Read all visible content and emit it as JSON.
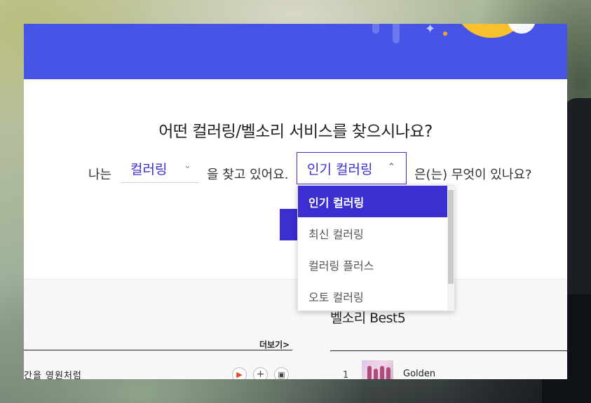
{
  "page": {
    "question": "어떤 컬러링/벨소리 서비스를 찾으시나요?",
    "sentence": {
      "prefix": "나는",
      "middle": "을 찾고 있어요.",
      "suffix": "은(는) 무엇이 있나요?"
    },
    "service_select": {
      "value": "컬러링"
    },
    "category_select": {
      "value": "인기 컬러링",
      "expanded": true,
      "options": [
        {
          "label": "인기 컬러링",
          "selected": true
        },
        {
          "label": "최신 컬러링",
          "selected": false
        },
        {
          "label": "컬러링 플러스",
          "selected": false
        },
        {
          "label": "오토 컬러링",
          "selected": false
        }
      ]
    }
  },
  "lower": {
    "more_link": "더보기>",
    "left_track": "간을 영원처럼",
    "bell_title": "벨소리 Best5",
    "bell_items": [
      {
        "rank": "1",
        "title": "Golden"
      }
    ]
  },
  "colors": {
    "accent": "#3b2fd1",
    "banner": "#4655e6"
  }
}
